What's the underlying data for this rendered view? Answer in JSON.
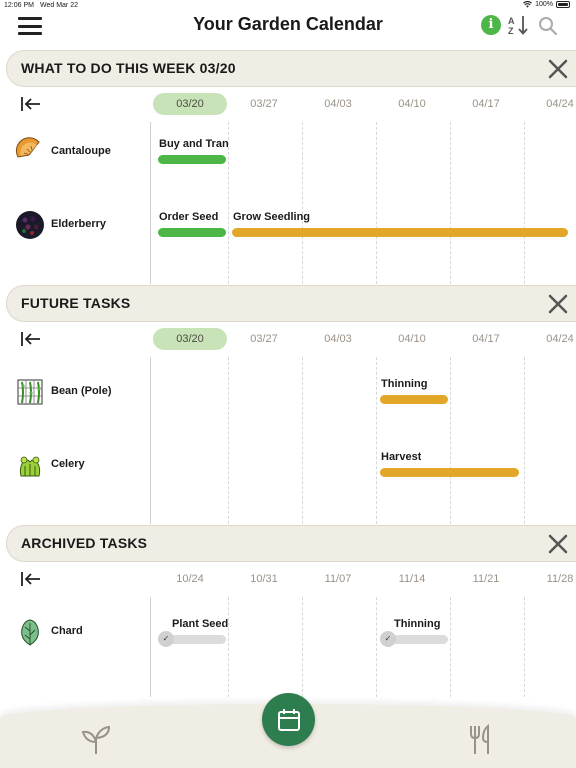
{
  "status": {
    "time": "12:06 PM",
    "date": "Wed Mar 22",
    "battery": "100%"
  },
  "header": {
    "title": "Your Garden Calendar",
    "info_glyph": "i"
  },
  "colors": {
    "accent_green": "#4cb646",
    "task_orange": "#e2a629",
    "fab_green": "#2e7d4f",
    "header_bg": "#f0ede4",
    "current_week": "#c8e3b8"
  },
  "sections": {
    "this_week": {
      "title": "WHAT TO DO THIS WEEK 03/20",
      "dates": [
        "03/20",
        "03/27",
        "04/03",
        "04/10",
        "04/17",
        "04/24"
      ],
      "plants": [
        {
          "name": "Cantaloupe",
          "icon": "cantaloupe-icon",
          "tasks": [
            {
              "label": "Buy and Tran...",
              "status": "current"
            }
          ]
        },
        {
          "name": "Elderberry",
          "icon": "elderberry-icon",
          "tasks": [
            {
              "label": "Order Seed",
              "status": "current"
            },
            {
              "label": "Grow Seedling",
              "status": "upcoming"
            }
          ]
        }
      ]
    },
    "future": {
      "title": "FUTURE TASKS",
      "dates": [
        "03/20",
        "03/27",
        "04/03",
        "04/10",
        "04/17",
        "04/24"
      ],
      "plants": [
        {
          "name": "Bean (Pole)",
          "icon": "bean-icon",
          "tasks": [
            {
              "label": "Thinning",
              "status": "upcoming"
            }
          ]
        },
        {
          "name": "Celery",
          "icon": "celery-icon",
          "tasks": [
            {
              "label": "Harvest",
              "status": "upcoming"
            }
          ]
        }
      ]
    },
    "archived": {
      "title": "ARCHIVED TASKS",
      "dates": [
        "10/24",
        "10/31",
        "11/07",
        "11/14",
        "11/21",
        "11/28"
      ],
      "plants": [
        {
          "name": "Chard",
          "icon": "chard-icon",
          "tasks": [
            {
              "label": "Plant Seed",
              "status": "done"
            },
            {
              "label": "Thinning",
              "status": "done"
            }
          ]
        }
      ]
    }
  },
  "nav": {
    "items": [
      "plant-icon",
      "calendar-icon",
      "utensils-icon"
    ],
    "active": "calendar-icon"
  }
}
